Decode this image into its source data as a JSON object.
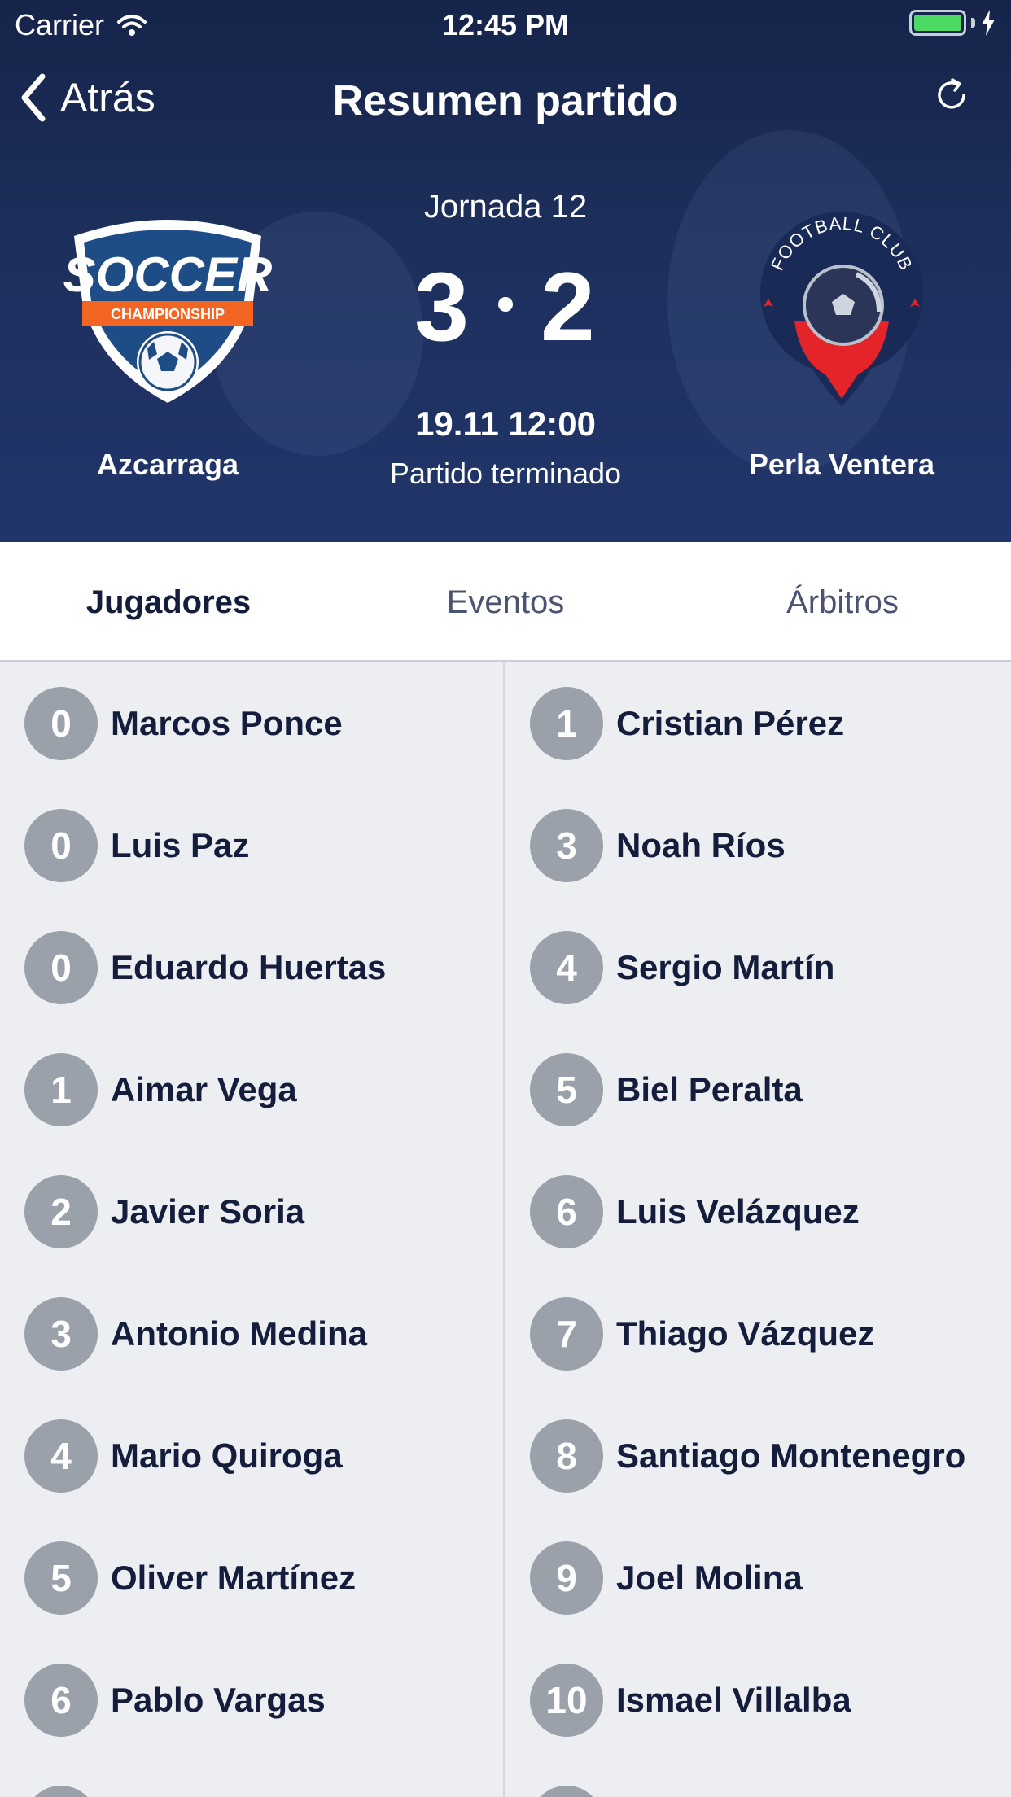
{
  "status_bar": {
    "carrier": "Carrier",
    "time": "12:45 PM",
    "battery_color": "#4cd964"
  },
  "nav": {
    "back_label": "Atrás",
    "title": "Resumen partido",
    "refresh_icon": "refresh-icon"
  },
  "match": {
    "round": "Jornada 12",
    "home_score": "3",
    "away_score": "2",
    "datetime": "19.11 12:00",
    "status": "Partido terminado",
    "home_team": {
      "name": "Azcarraga",
      "logo_text_top": "SOCCER",
      "logo_text_band": "CHAMPIONSHIP"
    },
    "away_team": {
      "name": "Perla Ventera",
      "logo_text": "FOOTBALL CLUB"
    }
  },
  "tabs": [
    {
      "label": "Jugadores",
      "active": true
    },
    {
      "label": "Eventos",
      "active": false
    },
    {
      "label": "Árbitros",
      "active": false
    }
  ],
  "home_players": [
    {
      "number": "0",
      "name": "Marcos Ponce"
    },
    {
      "number": "0",
      "name": "Luis Paz"
    },
    {
      "number": "0",
      "name": "Eduardo Huertas"
    },
    {
      "number": "1",
      "name": "Aimar Vega"
    },
    {
      "number": "2",
      "name": "Javier Soria"
    },
    {
      "number": "3",
      "name": "Antonio Medina"
    },
    {
      "number": "4",
      "name": "Mario Quiroga"
    },
    {
      "number": "5",
      "name": "Oliver Martínez"
    },
    {
      "number": "6",
      "name": "Pablo Vargas"
    }
  ],
  "away_players": [
    {
      "number": "1",
      "name": "Cristian Pérez"
    },
    {
      "number": "3",
      "name": "Noah Ríos"
    },
    {
      "number": "4",
      "name": "Sergio Martín"
    },
    {
      "number": "5",
      "name": "Biel Peralta"
    },
    {
      "number": "6",
      "name": "Luis Velázquez"
    },
    {
      "number": "7",
      "name": "Thiago Vázquez"
    },
    {
      "number": "8",
      "name": "Santiago Montenegro"
    },
    {
      "number": "9",
      "name": "Joel Molina"
    },
    {
      "number": "10",
      "name": "Ismael Villalba"
    }
  ],
  "colors": {
    "header_bg": "#1d2f5c",
    "number_badge": "#9aa1ab",
    "text_dark": "#141e3c",
    "logo_orange": "#f26522",
    "logo_red": "#e5242a"
  }
}
